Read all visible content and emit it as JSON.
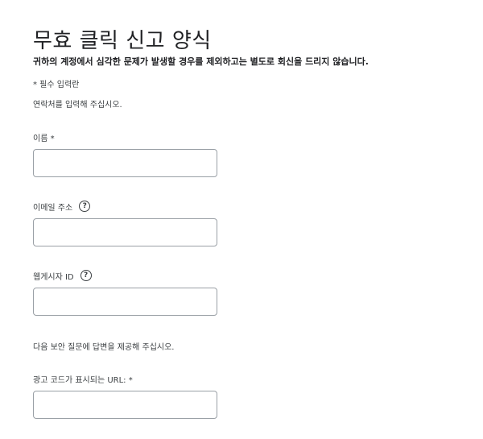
{
  "form": {
    "title": "무효 클릭 신고 양식",
    "notice": "귀하의 계정에서 심각한 문제가 발생할 경우를 제외하고는 별도로 회신을 드리지 않습니다.",
    "required_note": "* 필수 입력란",
    "contact_intro": "연락처를 입력해 주십시오.",
    "security_intro": "다음 보안 질문에 답변을 제공해 주십시오."
  },
  "fields": {
    "name": {
      "label": "이름 *",
      "value": "",
      "placeholder": ""
    },
    "email": {
      "label": "이메일 주소",
      "value": "",
      "placeholder": "",
      "help_icon": "help-circle-icon",
      "help_glyph": "?"
    },
    "publisher_id": {
      "label": "웹게시자 ID",
      "value": "",
      "placeholder": "",
      "help_icon": "help-circle-icon",
      "help_glyph": "?"
    },
    "ad_code_url": {
      "label": "광고 코드가 표시되는 URL: *",
      "value": "",
      "placeholder": ""
    }
  },
  "colors": {
    "text": "#202124",
    "secondary_text": "#3c4043",
    "input_border": "#9aa0a6"
  }
}
